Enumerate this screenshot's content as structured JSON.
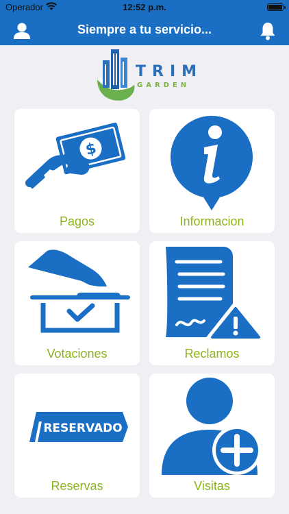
{
  "status_bar": {
    "carrier": "Operador",
    "time": "12:52 p.m.",
    "wifi_icon": "wifi-icon",
    "battery_icon": "battery-icon"
  },
  "nav": {
    "title": "Siempre a tu servicio...",
    "left_icon": "user-icon",
    "right_icon": "bell-icon",
    "background": "#1a6fc4"
  },
  "logo": {
    "line1": "TRIM",
    "line2": "GARDEN"
  },
  "menu": {
    "label_color": "#8ab31c",
    "icon_color": "#1a6fc4",
    "items": [
      {
        "label": "Pagos",
        "icon": "money-hand-icon"
      },
      {
        "label": "Informacion",
        "icon": "info-icon"
      },
      {
        "label": "Votaciones",
        "icon": "ballot-box-icon"
      },
      {
        "label": "Reclamos",
        "icon": "complaint-document-icon"
      },
      {
        "label": "Reservas",
        "icon": "reserved-sign-icon",
        "sign_text": "RESERVADO"
      },
      {
        "label": "Visitas",
        "icon": "add-person-icon"
      }
    ]
  }
}
